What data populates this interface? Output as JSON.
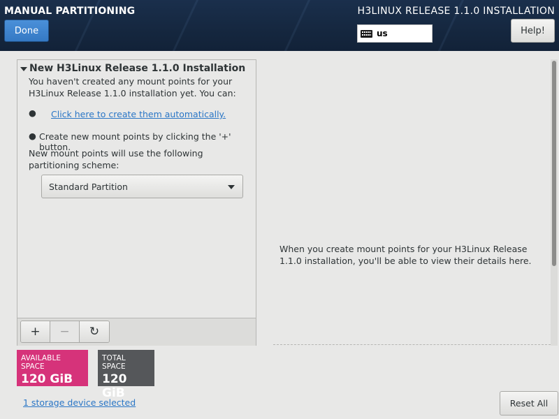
{
  "header": {
    "title": "MANUAL PARTITIONING",
    "release_title": "H3LINUX RELEASE 1.1.0 INSTALLATION",
    "done_label": "Done",
    "keyboard_layout": "us",
    "help_label": "Help!"
  },
  "left_panel": {
    "section_title": "New H3Linux Release 1.1.0 Installation",
    "intro_text": "You haven't created any mount points for your H3Linux Release 1.1.0 installation yet.  You can:",
    "bullet": "●",
    "auto_create_link": "Click here to create them automatically.",
    "manual_create_text": "Create new mount points by clicking the '+' button.",
    "scheme_text": "New mount points will use the following partitioning scheme:",
    "scheme_selected": "Standard Partition",
    "toolbar": {
      "add_icon": "+",
      "remove_icon": "−",
      "refresh_icon": "↻"
    }
  },
  "space": {
    "available_label": "AVAILABLE SPACE",
    "available_value": "120 GiB",
    "total_label": "TOTAL SPACE",
    "total_value": "120 GiB"
  },
  "storage_link": "1 storage device selected",
  "right_panel": {
    "info_text": "When you create mount points for your H3Linux Release 1.1.0 installation, you'll be able to view their details here."
  },
  "reset_label": "Reset All",
  "colors": {
    "header_bg": "#15273f",
    "accent_blue": "#3579c4",
    "available_space": "#d6337a",
    "total_space": "#55575a",
    "link": "#2a76c6"
  }
}
